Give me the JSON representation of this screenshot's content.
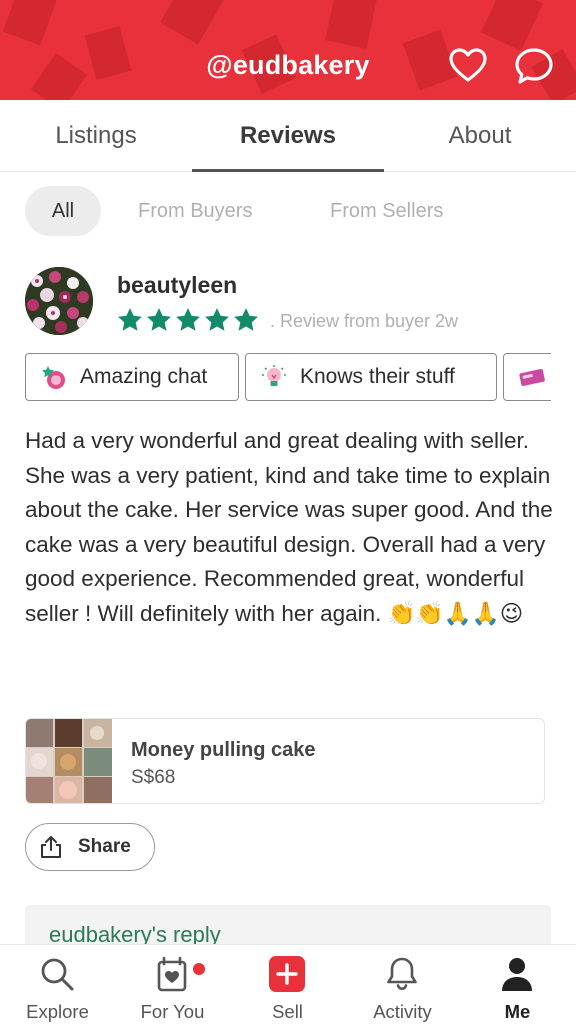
{
  "header": {
    "title": "@eudbakery",
    "accent_color": "#e8313a",
    "icons": [
      "heart-icon",
      "chat-bubble-icon"
    ]
  },
  "tabs": [
    {
      "label": "Listings",
      "active": false
    },
    {
      "label": "Reviews",
      "active": true
    },
    {
      "label": "About",
      "active": false
    }
  ],
  "filters": [
    {
      "label": "All",
      "selected": true
    },
    {
      "label": "From Buyers",
      "selected": false
    },
    {
      "label": "From Sellers",
      "selected": false
    }
  ],
  "review": {
    "username": "beautyleen",
    "rating": 5,
    "rating_max": 5,
    "meta": ". Review from buyer  2w",
    "chips": [
      {
        "label": "Amazing chat",
        "icon": "chat-badge-icon"
      },
      {
        "label": "Knows their stuff",
        "icon": "lightbulb-icon"
      },
      {
        "label": "",
        "icon": "ticket-icon"
      }
    ],
    "text": "Had a very wonderful and great dealing with seller. She was a very patient, kind and take time to explain about the cake.  Her service was super good. And the cake was a very beautiful design. Overall had a very good experience. Recommended great, wonderful seller ! Will definitely with her again. 👏👏🙏🙏😉",
    "listing": {
      "name": "Money pulling cake",
      "price": "S$68"
    },
    "share_label": "Share",
    "reply_label": "eudbakery's reply"
  },
  "bottom_nav": [
    {
      "label": "Explore",
      "icon": "search-icon"
    },
    {
      "label": "For You",
      "icon": "for-you-icon",
      "badge": true
    },
    {
      "label": "Sell",
      "icon": "plus-icon"
    },
    {
      "label": "Activity",
      "icon": "bell-icon"
    },
    {
      "label": "Me",
      "icon": "person-icon",
      "active": true
    }
  ],
  "colors": {
    "star": "#128b6b",
    "reply_text": "#2a7a5b",
    "badge": "#e8313a"
  }
}
